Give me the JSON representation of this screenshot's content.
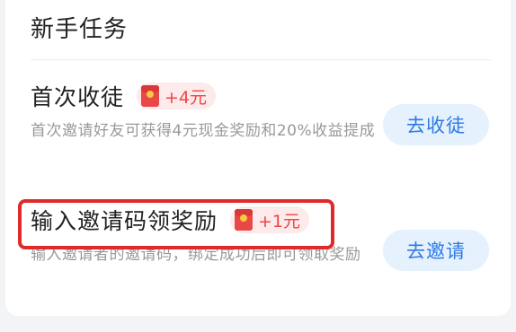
{
  "section": {
    "title": "新手任务"
  },
  "tasks": [
    {
      "title": "首次收徒",
      "reward": "+4元",
      "description": "首次邀请好友可获得4元现金奖励和20%收益提成",
      "action": "去收徒"
    },
    {
      "title": "输入邀请码领奖励",
      "reward": "+1元",
      "description": "输入邀请者的邀请码，绑定成功后即可领取奖励",
      "action": "去邀请"
    }
  ],
  "colors": {
    "accent": "#2d7ae6",
    "accent_bg": "#e5f1fd",
    "reward": "#f04444",
    "reward_bg": "#fdeaea",
    "highlight": "#e02a2a"
  },
  "icons": {
    "reward": "red-envelope-icon"
  }
}
